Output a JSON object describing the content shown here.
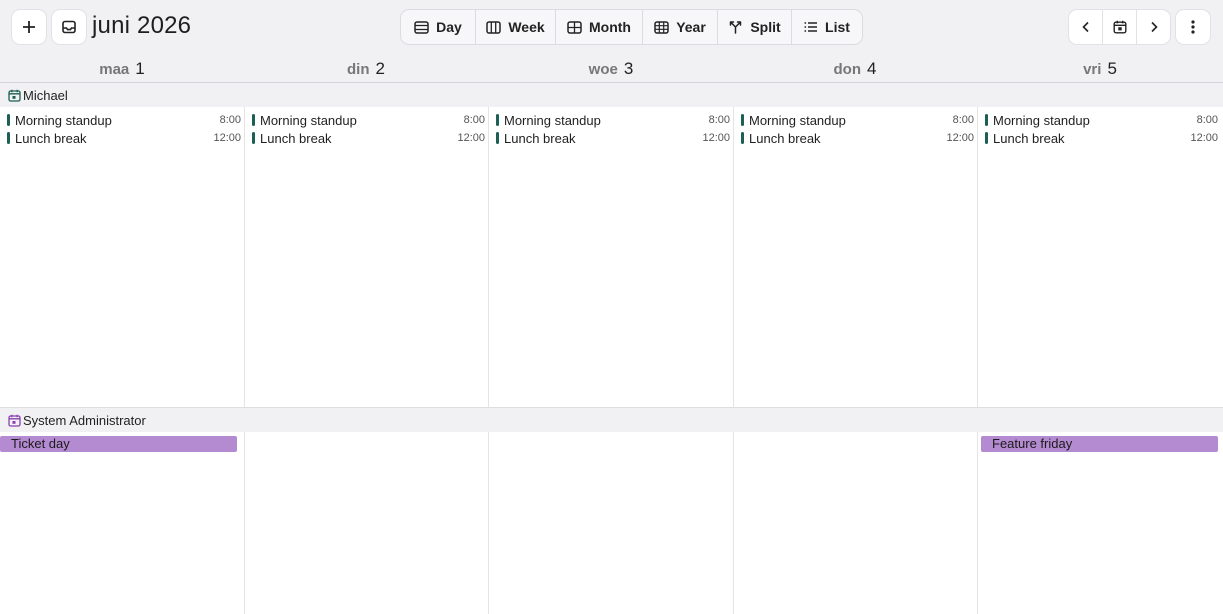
{
  "toolbar": {
    "title": "juni 2026",
    "views": [
      {
        "label": "Day",
        "icon": "day-view-icon"
      },
      {
        "label": "Week",
        "icon": "week-view-icon"
      },
      {
        "label": "Month",
        "icon": "month-view-icon"
      },
      {
        "label": "Year",
        "icon": "year-view-icon"
      },
      {
        "label": "Split",
        "icon": "split-view-icon"
      },
      {
        "label": "List",
        "icon": "list-view-icon"
      }
    ]
  },
  "days": [
    {
      "weekday": "maa",
      "num": "1"
    },
    {
      "weekday": "din",
      "num": "2"
    },
    {
      "weekday": "woe",
      "num": "3"
    },
    {
      "weekday": "don",
      "num": "4"
    },
    {
      "weekday": "vri",
      "num": "5"
    }
  ],
  "calendars": [
    {
      "name": "Michael",
      "color": "#1d5e55",
      "events": [
        {
          "title": "Morning standup",
          "time": "8:00"
        },
        {
          "title": "Lunch break",
          "time": "12:00"
        }
      ]
    },
    {
      "name": "System Administrator",
      "color": "#8a3fb0",
      "allday": [
        {
          "title": "Ticket day",
          "day": 0
        },
        {
          "title": "Feature friday",
          "day": 4
        }
      ]
    }
  ],
  "colors": {
    "event_bar": "#1d5e55",
    "allday_fill": "#b48ad0"
  }
}
